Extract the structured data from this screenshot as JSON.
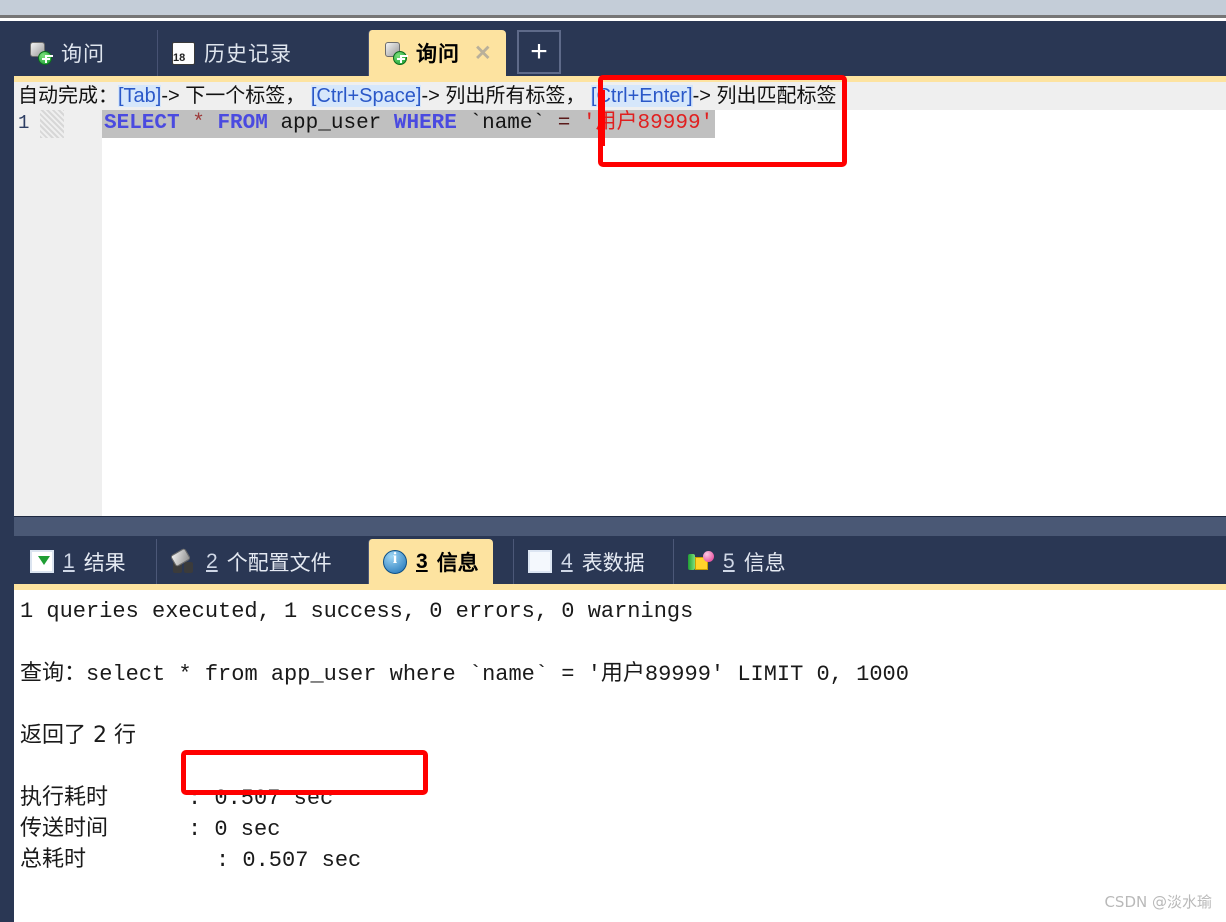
{
  "window": {
    "colors": {
      "chrome_top": "#c4cdd8",
      "frame_navy": "#2a3754",
      "active_tab": "#fde3a0",
      "annotation_red": "#ff0000",
      "hint_bg": "#efefef",
      "code_selection": "#c0c0c0"
    }
  },
  "editor_tabs": [
    {
      "id": "query-1",
      "icon": "query-icon",
      "label": "询问",
      "active": false,
      "closable": false
    },
    {
      "id": "history",
      "icon": "calendar-icon",
      "label": "历史记录",
      "active": false,
      "closable": false
    },
    {
      "id": "query-2",
      "icon": "query-icon",
      "label": "询问",
      "active": true,
      "closable": true,
      "close_glyph": "✕"
    }
  ],
  "new_tab_button": {
    "label": "+",
    "name": "new-tab-button"
  },
  "hint_bar": {
    "prefix": "自动完成：",
    "items": [
      {
        "key": "[Tab]",
        "arrow": "-> ",
        "text": "下一个标签，"
      },
      {
        "key": "[Ctrl+Space]",
        "arrow": "-> ",
        "text": "列出所有标签，"
      },
      {
        "key": "[Ctrl+Enter]",
        "arrow": "-> ",
        "text": "列出匹配标签"
      }
    ]
  },
  "code": {
    "line_number": "1",
    "tokens": [
      {
        "text": "SELECT ",
        "type": "keyword"
      },
      {
        "text": "* ",
        "type": "star"
      },
      {
        "text": "FROM ",
        "type": "keyword"
      },
      {
        "text": "app_user ",
        "type": "identifier"
      },
      {
        "text": "WHERE ",
        "type": "keyword"
      },
      {
        "text": "`name` ",
        "type": "backtick"
      },
      {
        "text": "= ",
        "type": "operator"
      },
      {
        "text": "'用户89999'",
        "type": "string"
      }
    ],
    "full_text": "SELECT * FROM app_user WHERE `name` = '用户89999'"
  },
  "result_tabs": [
    {
      "id": "result",
      "icon": "grid-download-icon",
      "num": "1",
      "label": "结果",
      "active": false
    },
    {
      "id": "profile",
      "icon": "binoculars-icon",
      "num": "2",
      "label": "个配置文件",
      "active": false
    },
    {
      "id": "message",
      "icon": "info-icon",
      "num": "3",
      "label": "信息",
      "active": true
    },
    {
      "id": "tabledata",
      "icon": "table-icon",
      "num": "4",
      "label": "表数据",
      "active": false
    },
    {
      "id": "status",
      "icon": "shapes-icon",
      "num": "5",
      "label": "信息",
      "active": false
    }
  ],
  "output": {
    "summary": "1 queries executed, 1 success, 0 errors, 0 warnings",
    "query_label": "查询：",
    "query_text": "select * from app_user where `name` = '用户89999' LIMIT 0, 1000",
    "rows_returned": "返回了 2 行",
    "timings": [
      {
        "label": "执行耗时",
        "sep": ":",
        "value": "0.507 sec",
        "pad": 3
      },
      {
        "label": "传送时间",
        "sep": ":",
        "value": "0 sec",
        "pad": 3
      },
      {
        "label": "总耗时",
        "sep": ":",
        "value": "0.507 sec",
        "pad": 6
      }
    ]
  },
  "annotations": [
    {
      "id": "annot-sql",
      "name": "sql-value-highlight-box",
      "color": "#ff0000"
    },
    {
      "id": "annot-time",
      "name": "exec-time-highlight-box",
      "color": "#ff0000"
    }
  ],
  "watermark": {
    "text": "CSDN @淡水瑜"
  }
}
